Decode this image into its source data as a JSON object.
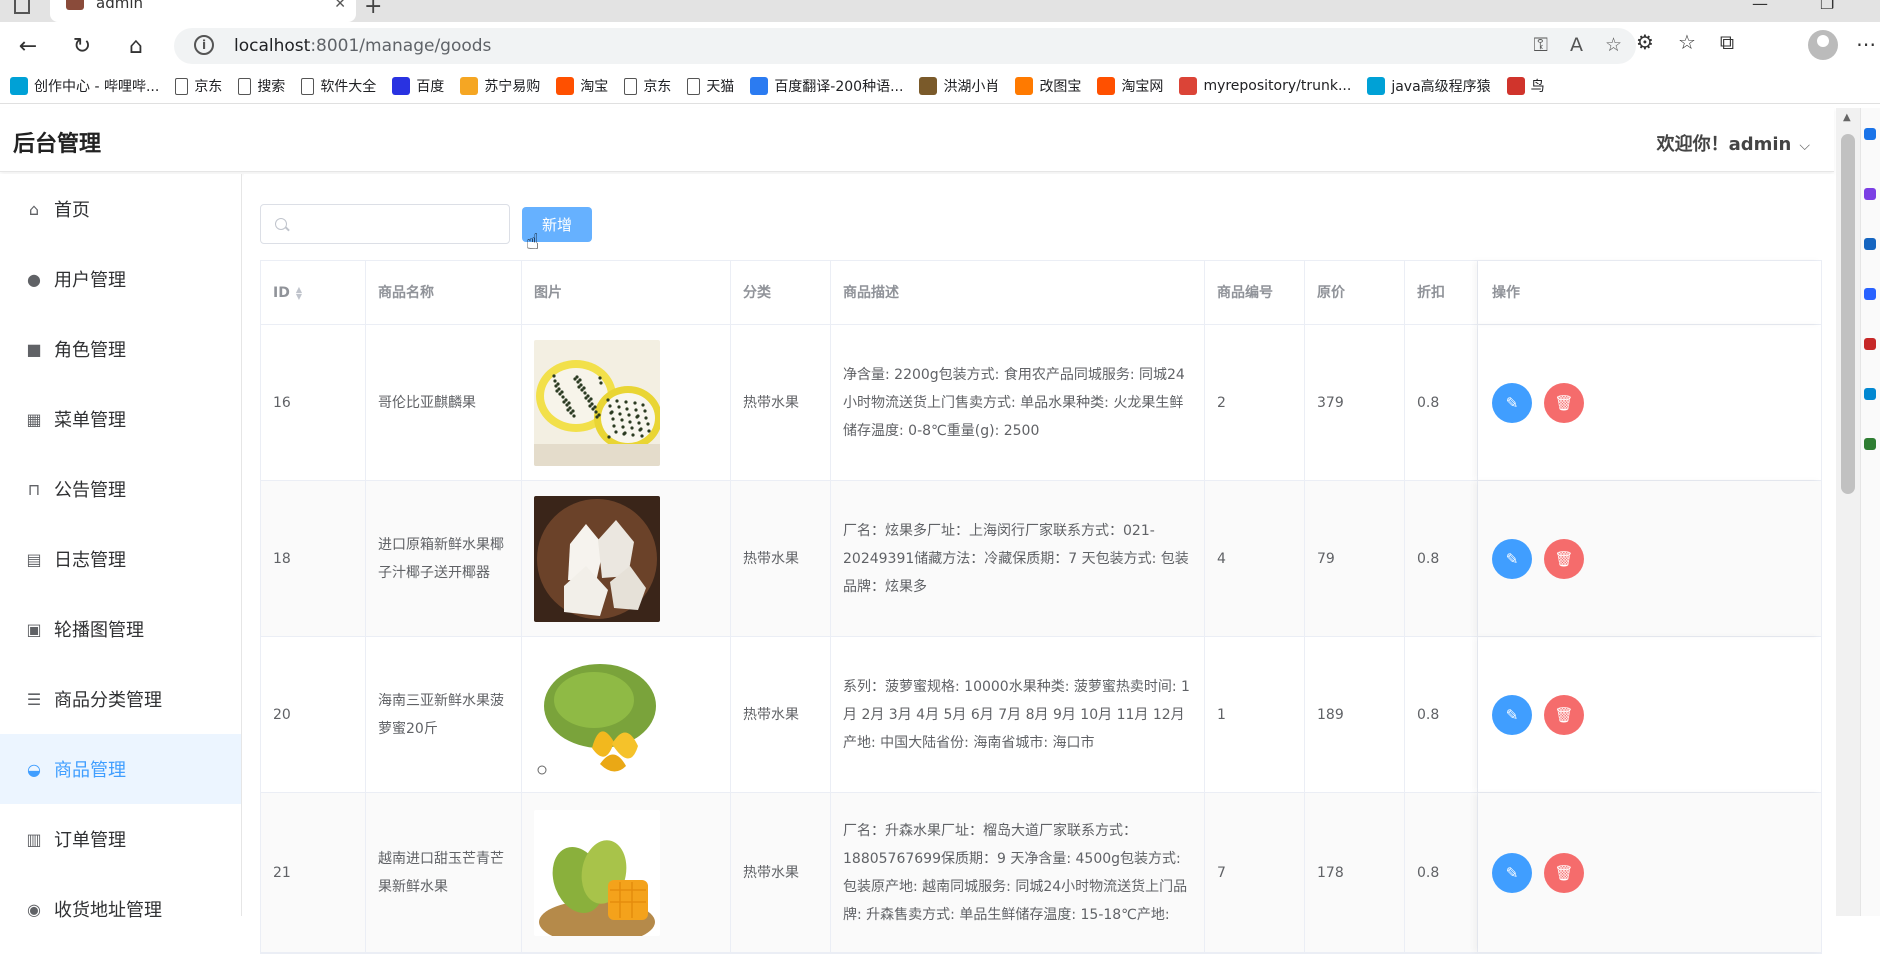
{
  "browser": {
    "tab_title": "admin",
    "url_host": "localhost",
    "url_rest": ":8001/manage/goods",
    "bookmarks": [
      {
        "label": "创作中心 - 哔哩哔...",
        "icon": "bilibili-icon",
        "color": "#00a1d6"
      },
      {
        "label": "京东",
        "icon": "document-icon",
        "color": "#555555"
      },
      {
        "label": "搜索",
        "icon": "document-icon",
        "color": "#555555"
      },
      {
        "label": "软件大全",
        "icon": "document-icon",
        "color": "#555555"
      },
      {
        "label": "百度",
        "icon": "baidu-icon",
        "color": "#2932e1"
      },
      {
        "label": "苏宁易购",
        "icon": "suning-icon",
        "color": "#f5a623"
      },
      {
        "label": "淘宝",
        "icon": "taobao-icon",
        "color": "#ff5000"
      },
      {
        "label": "京东",
        "icon": "document-icon",
        "color": "#555555"
      },
      {
        "label": "天猫",
        "icon": "document-icon",
        "color": "#555555"
      },
      {
        "label": "百度翻译-200种语...",
        "icon": "translate-icon",
        "color": "#2b7bf1"
      },
      {
        "label": "洪湖小肖",
        "icon": "bird-icon",
        "color": "#7a5a2a"
      },
      {
        "label": "改图宝",
        "icon": "gaitubao-icon",
        "color": "#ff7a00"
      },
      {
        "label": "淘宝网",
        "icon": "taobao-icon",
        "color": "#ff5000"
      },
      {
        "label": "myrepository/trunk...",
        "icon": "chrome-icon",
        "color": "#db4437"
      },
      {
        "label": "java高级程序猿",
        "icon": "bilibili-icon",
        "color": "#00a1d6"
      },
      {
        "label": "鸟",
        "icon": "bird-icon",
        "color": "#d0342c"
      }
    ]
  },
  "header": {
    "brand": "后台管理",
    "welcome": "欢迎你！admin"
  },
  "sidebar": {
    "items": [
      {
        "label": "首页",
        "icon": "home-icon",
        "glyph": "⌂",
        "active": false
      },
      {
        "label": "用户管理",
        "icon": "user-icon",
        "glyph": "●",
        "active": false
      },
      {
        "label": "角色管理",
        "icon": "briefcase-icon",
        "glyph": "■",
        "active": false
      },
      {
        "label": "菜单管理",
        "icon": "grid-icon",
        "glyph": "▦",
        "active": false
      },
      {
        "label": "公告管理",
        "icon": "easel-icon",
        "glyph": "⊓",
        "active": false
      },
      {
        "label": "日志管理",
        "icon": "notebook-icon",
        "glyph": "▤",
        "active": false
      },
      {
        "label": "轮播图管理",
        "icon": "picture-icon",
        "glyph": "▣",
        "active": false
      },
      {
        "label": "商品分类管理",
        "icon": "list-icon",
        "glyph": "☰",
        "active": false
      },
      {
        "label": "商品管理",
        "icon": "shopping-bag-icon",
        "glyph": "◒",
        "active": true
      },
      {
        "label": "订单管理",
        "icon": "bar-chart-icon",
        "glyph": "▥",
        "active": false
      },
      {
        "label": "收货地址管理",
        "icon": "location-icon",
        "glyph": "◉",
        "active": false
      }
    ]
  },
  "toolbar": {
    "search_placeholder": "",
    "add_label": "新增"
  },
  "table": {
    "columns": [
      "ID",
      "商品名称",
      "图片",
      "分类",
      "商品描述",
      "商品编号",
      "原价",
      "折扣",
      "操作"
    ],
    "rows": [
      {
        "id": "16",
        "name": "哥伦比亚麒麟果",
        "image": "dragon-fruit",
        "category": "热带水果",
        "desc": "净含量: 2200g包装方式: 食用农产品同城服务: 同城24小时物流送货上门售卖方式: 单品水果种类: 火龙果生鲜储存温度: 0-8℃重量(g): 2500",
        "code": "2",
        "price": "379",
        "discount": "0.8"
      },
      {
        "id": "18",
        "name": "进口原箱新鲜水果椰子汁椰子送开椰器",
        "image": "coconut",
        "category": "热带水果",
        "desc": "厂名：炫果多厂址：上海闵行厂家联系方式：021-20249391储藏方法：冷藏保质期：7 天包装方式: 包装品牌：炫果多",
        "code": "4",
        "price": "79",
        "discount": "0.8"
      },
      {
        "id": "20",
        "name": "海南三亚新鲜水果菠萝蜜20斤",
        "image": "jackfruit",
        "category": "热带水果",
        "desc": "系列：菠萝蜜规格: 10000水果种类: 菠萝蜜热卖时间: 1月 2月 3月 4月 5月 6月 7月 8月 9月 10月 11月 12月产地: 中国大陆省份: 海南省城市: 海口市",
        "code": "1",
        "price": "189",
        "discount": "0.8"
      },
      {
        "id": "21",
        "name": "越南进口甜玉芒青芒果新鲜水果",
        "image": "mango",
        "category": "热带水果",
        "desc": "厂名：升森水果厂址：榴岛大道厂家联系方式：18805767699保质期：9 天净含量: 4500g包装方式: 包装原产地: 越南同城服务: 同城24小时物流送货上门品牌: 升森售卖方式: 单品生鲜储存温度: 15-18℃产地:",
        "code": "7",
        "price": "178",
        "discount": "0.8"
      }
    ]
  },
  "colors": {
    "primary": "#409eff",
    "danger": "#f56c6c",
    "active_bg": "#ecf5ff",
    "add_button": "#66b1ff"
  }
}
